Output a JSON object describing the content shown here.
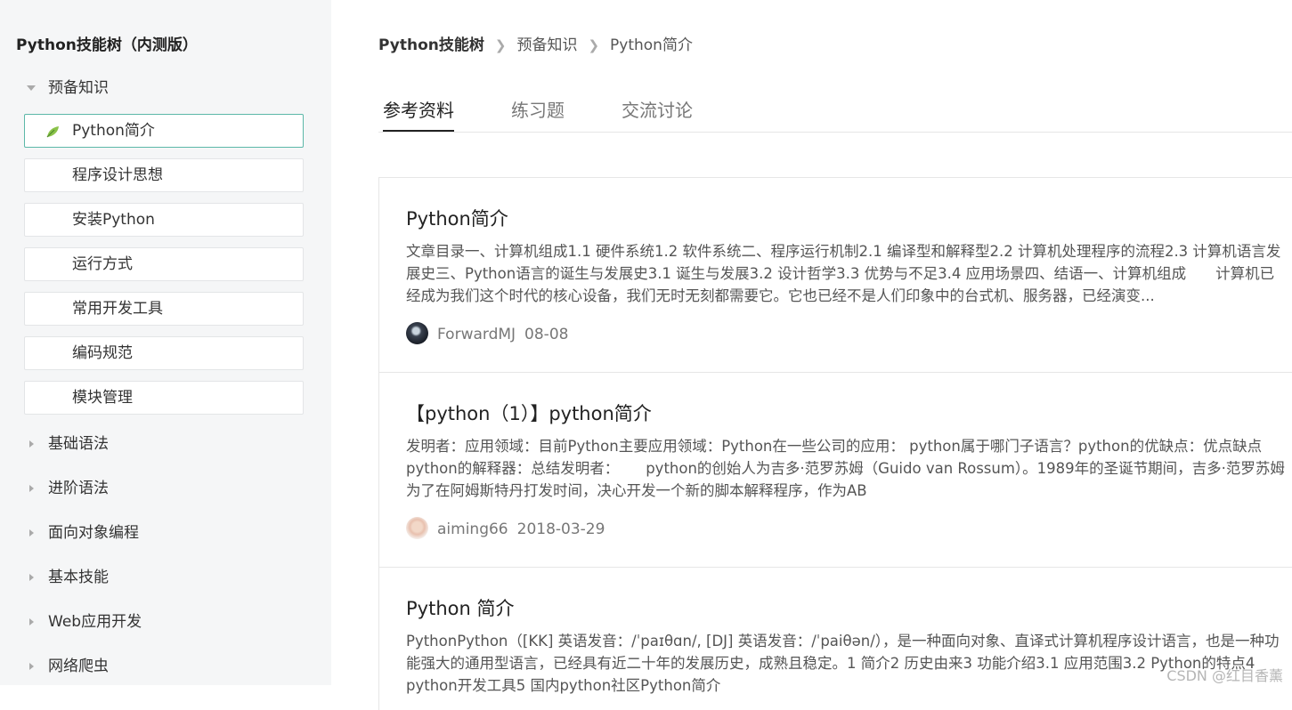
{
  "sidebar": {
    "title": "Python技能树（内测版）",
    "open_group": "预备知识",
    "leaves": [
      {
        "label": "Python简介",
        "active": true
      },
      {
        "label": "程序设计思想",
        "active": false
      },
      {
        "label": "安装Python",
        "active": false
      },
      {
        "label": "运行方式",
        "active": false
      },
      {
        "label": "常用开发工具",
        "active": false
      },
      {
        "label": "编码规范",
        "active": false
      },
      {
        "label": "模块管理",
        "active": false
      }
    ],
    "groups": [
      "基础语法",
      "进阶语法",
      "面向对象编程",
      "基本技能",
      "Web应用开发",
      "网络爬虫"
    ]
  },
  "breadcrumb": [
    "Python技能树",
    "预备知识",
    "Python简介"
  ],
  "tabs": [
    {
      "label": "参考资料",
      "active": true
    },
    {
      "label": "练习题",
      "active": false
    },
    {
      "label": "交流讨论",
      "active": false
    }
  ],
  "cards": [
    {
      "title": "Python简介",
      "desc": "文章目录一、计算机组成1.1 硬件系统1.2 软件系统二、程序运行机制2.1 编译型和解释型2.2 计算机处理程序的流程2.3 计算机语言发展史三、Python语言的诞生与发展史3.1 诞生与发展3.2 设计哲学3.3 优势与不足3.4 应用场景四、结语一、计算机组成　　计算机已经成为我们这个时代的核心设备，我们无时无刻都需要它。它也已经不是人们印象中的台式机、服务器，已经演变...",
      "author": "ForwardMJ",
      "date": "08-08"
    },
    {
      "title": "【python（1）】python简介",
      "desc": "发明者：应用领域：目前Python主要应用领域：Python在一些公司的应用： python属于哪门子语言？python的优缺点：优点缺点 python的解释器：总结发明者：　　 python的创始人为吉多·范罗苏姆（Guido van Rossum）。1989年的圣诞节期间，吉多·范罗苏姆为了在阿姆斯特丹打发时间，决心开发一个新的脚本解释程序，作为AB",
      "author": "aiming66",
      "date": "2018-03-29"
    },
    {
      "title": "Python 简介",
      "desc": "PythonPython（[KK] 英语发音：/ˈpaɪθɑn/, [DJ] 英语发音：/ˈpaiθən/），是一种面向对象、直译式计算机程序设计语言，也是一种功能强大的通用型语言，已经具有近二十年的发展历史，成熟且稳定。1 简介2 历史由来3 功能介绍3.1 应用范围3.2 Python的特点4 python开发工具5 国内python社区Python简介",
      "author": "",
      "date": ""
    }
  ],
  "watermark": "CSDN @红目香薰"
}
